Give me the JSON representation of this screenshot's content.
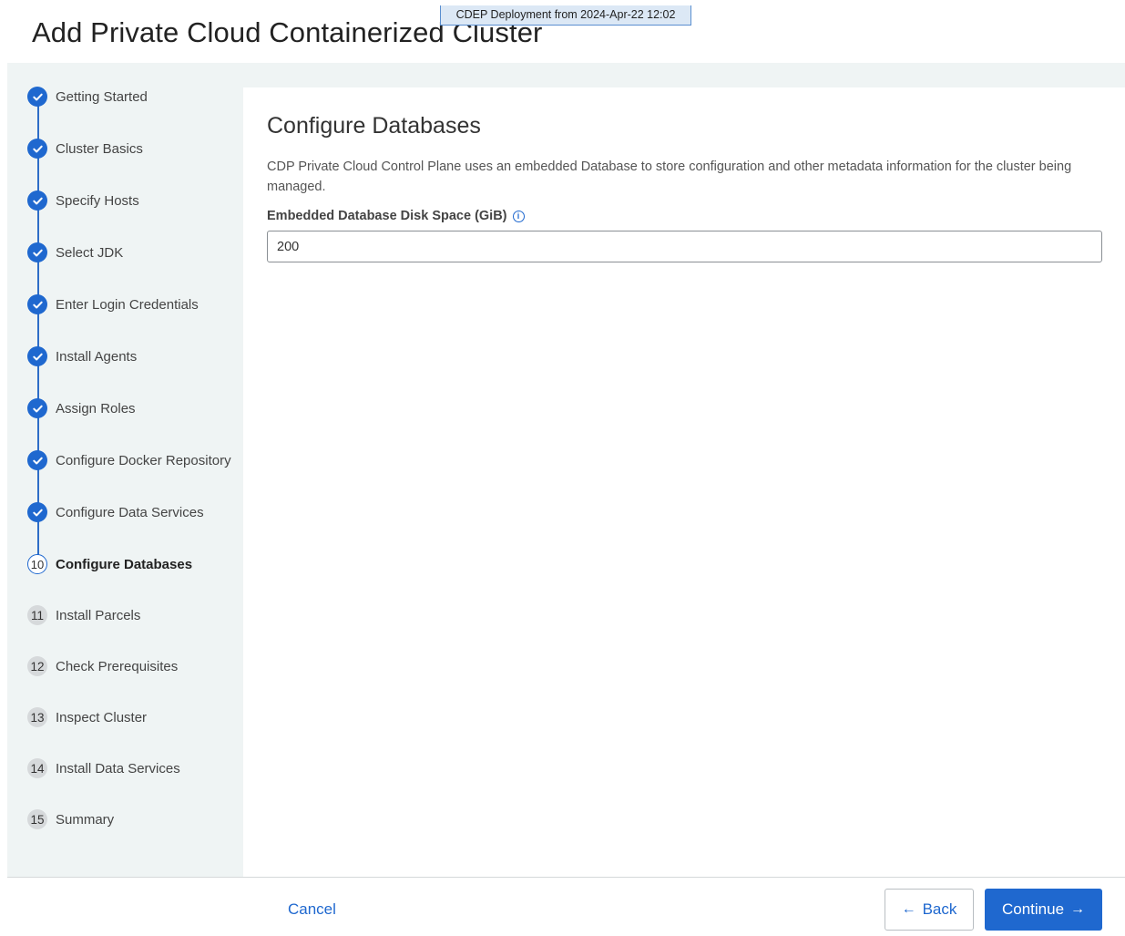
{
  "banner": {
    "text": "CDEP Deployment from 2024-Apr-22 12:02"
  },
  "page": {
    "title": "Add Private Cloud Containerized Cluster"
  },
  "steps": [
    {
      "label": "Getting Started",
      "state": "done"
    },
    {
      "label": "Cluster Basics",
      "state": "done"
    },
    {
      "label": "Specify Hosts",
      "state": "done"
    },
    {
      "label": "Select JDK",
      "state": "done"
    },
    {
      "label": "Enter Login Credentials",
      "state": "done"
    },
    {
      "label": "Install Agents",
      "state": "done"
    },
    {
      "label": "Assign Roles",
      "state": "done"
    },
    {
      "label": "Configure Docker Repository",
      "state": "done"
    },
    {
      "label": "Configure Data Services",
      "state": "done"
    },
    {
      "number": "10",
      "label": "Configure Databases",
      "state": "current"
    },
    {
      "number": "11",
      "label": "Install Parcels",
      "state": "todo"
    },
    {
      "number": "12",
      "label": "Check Prerequisites",
      "state": "todo"
    },
    {
      "number": "13",
      "label": "Inspect Cluster",
      "state": "todo"
    },
    {
      "number": "14",
      "label": "Install Data Services",
      "state": "todo"
    },
    {
      "number": "15",
      "label": "Summary",
      "state": "todo"
    }
  ],
  "main": {
    "title": "Configure Databases",
    "description": "CDP Private Cloud Control Plane uses an embedded Database to store configuration and other metadata information for the cluster being managed.",
    "field": {
      "label": "Embedded Database Disk Space (GiB)",
      "value": "200",
      "info_icon": "info-icon"
    }
  },
  "footer": {
    "cancel_label": "Cancel",
    "back_label": "Back",
    "continue_label": "Continue"
  },
  "colors": {
    "accent": "#1f68cf",
    "sidebar_bg": "#eff4f4",
    "todo_badge": "#d6d9db"
  }
}
